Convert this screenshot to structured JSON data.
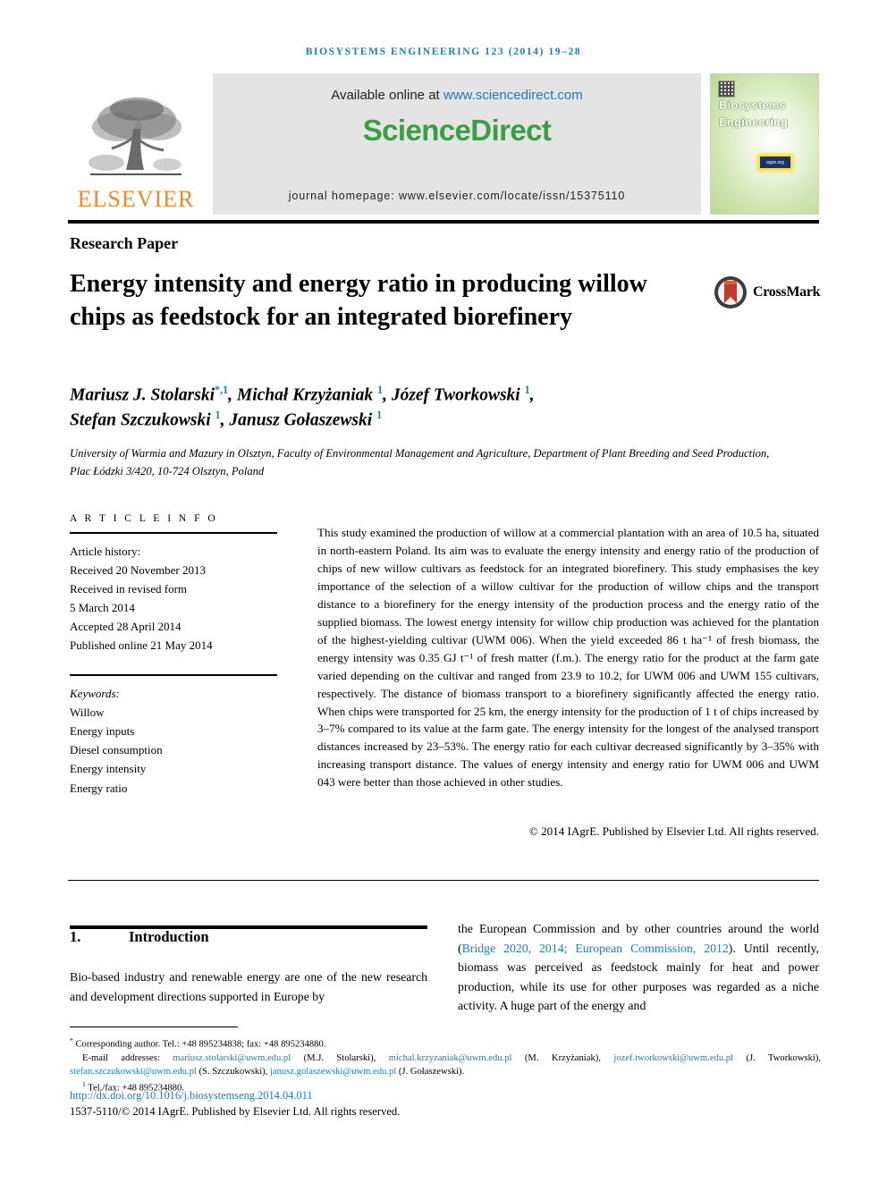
{
  "running_head": "BIOSYSTEMS ENGINEERING 123 (2014) 19–28",
  "masthead": {
    "publisher_name": "ELSEVIER",
    "publisher_logo_icon": "elsevier-tree-icon",
    "available_online_prefix": "Available online at ",
    "available_online_url": "www.sciencedirect.com",
    "sciencedirect_logo": "ScienceDirect",
    "journal_homepage": "journal homepage: www.elsevier.com/locate/issn/15375110",
    "cover": {
      "title_line1": "Biosystems",
      "title_line2": "Engineering",
      "qr_icon": "qr-code-icon",
      "badge_label": "iagre.org"
    }
  },
  "article": {
    "type": "Research Paper",
    "title": "Energy intensity and energy ratio in producing willow chips as feedstock for an integrated biorefinery",
    "crossmark_label": "CrossMark",
    "crossmark_icon": "crossmark-badge-icon",
    "authors_html": "Mariusz J. Stolarski<sup>*,1</sup>, Michał Krzyżaniak <sup>1</sup>, Józef Tworkowski <sup>1</sup>,<br>Stefan Szczukowski <sup>1</sup>, Janusz Gołaszewski <sup>1</sup>",
    "affiliation": "University of Warmia and Mazury in Olsztyn, Faculty of Environmental Management and Agriculture, Department of Plant Breeding and Seed Production, Plac Łódzki 3/420, 10-724 Olsztyn, Poland"
  },
  "article_info": {
    "heading": "A R T I C L E   I N F O",
    "history_label": "Article history:",
    "history": [
      "Received 20 November 2013",
      "Received in revised form",
      "5 March 2014",
      "Accepted 28 April 2014",
      "Published online 21 May 2014"
    ],
    "keywords_label": "Keywords:",
    "keywords": [
      "Willow",
      "Energy inputs",
      "Diesel consumption",
      "Energy intensity",
      "Energy ratio"
    ]
  },
  "abstract": {
    "text": "This study examined the production of willow at a commercial plantation with an area of 10.5 ha, situated in north-eastern Poland. Its aim was to evaluate the energy intensity and energy ratio of the production of chips of new willow cultivars as feedstock for an integrated biorefinery. This study emphasises the key importance of the selection of a willow cultivar for the production of willow chips and the transport distance to a biorefinery for the energy intensity of the production process and the energy ratio of the supplied biomass. The lowest energy intensity for willow chip production was achieved for the plantation of the highest-yielding cultivar (UWM 006). When the yield exceeded 86 t ha⁻¹ of fresh biomass, the energy intensity was 0.35 GJ t⁻¹ of fresh matter (f.m.). The energy ratio for the product at the farm gate varied depending on the cultivar and ranged from 23.9 to 10.2, for UWM 006 and UWM 155 cultivars, respectively. The distance of biomass transport to a biorefinery significantly affected the energy ratio. When chips were transported for 25 km, the energy intensity for the production of 1 t of chips increased by 3–7% compared to its value at the farm gate. The energy intensity for the longest of the analysed transport distances increased by 23–53%. The energy ratio for each cultivar decreased significantly by 3–35% with increasing transport distance. The values of energy intensity and energy ratio for UWM 006 and UWM 043 were better than those achieved in other studies.",
    "copyright": "© 2014 IAgrE. Published by Elsevier Ltd. All rights reserved."
  },
  "body": {
    "section_number": "1.",
    "section_title": "Introduction",
    "left_paragraph": "Bio-based industry and renewable energy are one of the new research and development directions supported in Europe by",
    "right_paragraph_pre": "the European Commission and by other countries around the world (",
    "right_citation": "Bridge 2020, 2014; European Commission, 2012",
    "right_paragraph_post": "). Until recently, biomass was perceived as feedstock mainly for heat and power production, while its use for other purposes was regarded as a niche activity. A huge part of the energy and"
  },
  "footnotes": {
    "corresponding": "Corresponding author. Tel.: +48 895234838; fax: +48 895234880.",
    "email_label": "E-mail addresses:",
    "emails": [
      {
        "address": "mariusz.stolarski@uwm.edu.pl",
        "person": "(M.J. Stolarski)"
      },
      {
        "address": "michal.krzyzaniak@uwm.edu.pl",
        "person": "(M. Krzyżaniak)"
      },
      {
        "address": "jozef.tworkowski@uwm.edu.pl",
        "person": "(J. Tworkowski)"
      },
      {
        "address": "stefan.szczukowski@uwm.edu.pl",
        "person": "(S. Szczukowski)"
      },
      {
        "address": "janusz.golaszewski@uwm.edu.pl",
        "person": "(J. Gołaszewski)"
      }
    ],
    "tel_fax": "Tel./fax: +48 895234880.",
    "doi": "http://dx.doi.org/10.1016/j.biosystemseng.2014.04.011",
    "issn_line": "1537-5110/© 2014 IAgrE. Published by Elsevier Ltd. All rights reserved."
  },
  "colors": {
    "link_blue": "#1a7fc1",
    "sciencedirect_green": "#3a9e45",
    "elsevier_orange": "#f08a22",
    "crossmark_red": "#c0392b"
  }
}
